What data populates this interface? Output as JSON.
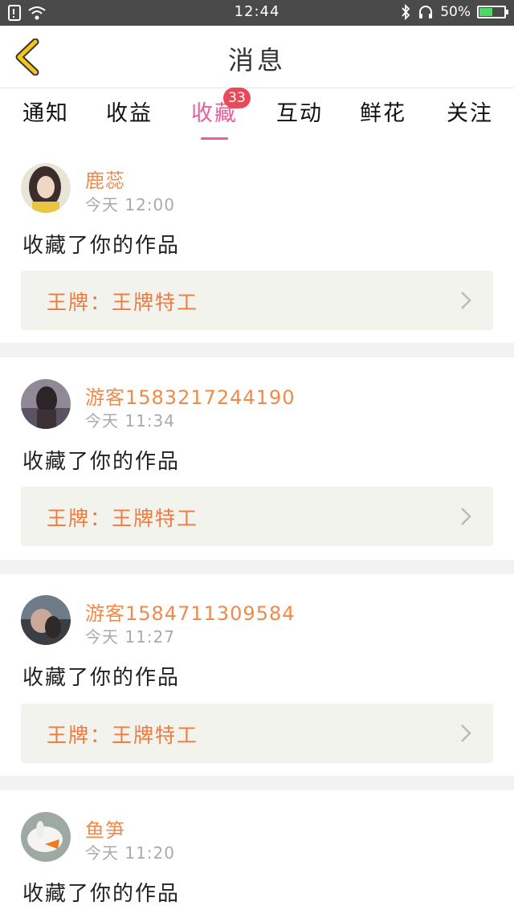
{
  "status_bar": {
    "time": "12:44",
    "battery": "50%",
    "battery_level": 0.5
  },
  "header": {
    "title": "消息",
    "back_icon": "chevron-left-icon"
  },
  "tabs": [
    {
      "label": "通知"
    },
    {
      "label": "收益"
    },
    {
      "label": "收藏",
      "active": true,
      "badge": "33"
    },
    {
      "label": "互动"
    },
    {
      "label": "鲜花"
    },
    {
      "label": "关注"
    }
  ],
  "messages": [
    {
      "username": "鹿蕊",
      "time": "今天 12:00",
      "action": "收藏了你的作品",
      "work": "王牌：王牌特工"
    },
    {
      "username": "游客1583217244190",
      "time": "今天 11:34",
      "action": "收藏了你的作品",
      "work": "王牌：王牌特工"
    },
    {
      "username": "游客1584711309584",
      "time": "今天 11:27",
      "action": "收藏了你的作品",
      "work": "王牌：王牌特工"
    },
    {
      "username": "鱼笋",
      "time": "今天 11:20",
      "action": "收藏了你的作品"
    }
  ],
  "colors": {
    "accent_pink": "#e85d9a",
    "username_orange": "#f08a4b",
    "badge_red": "#e84a5a",
    "back_yellow": "#f5c518"
  }
}
